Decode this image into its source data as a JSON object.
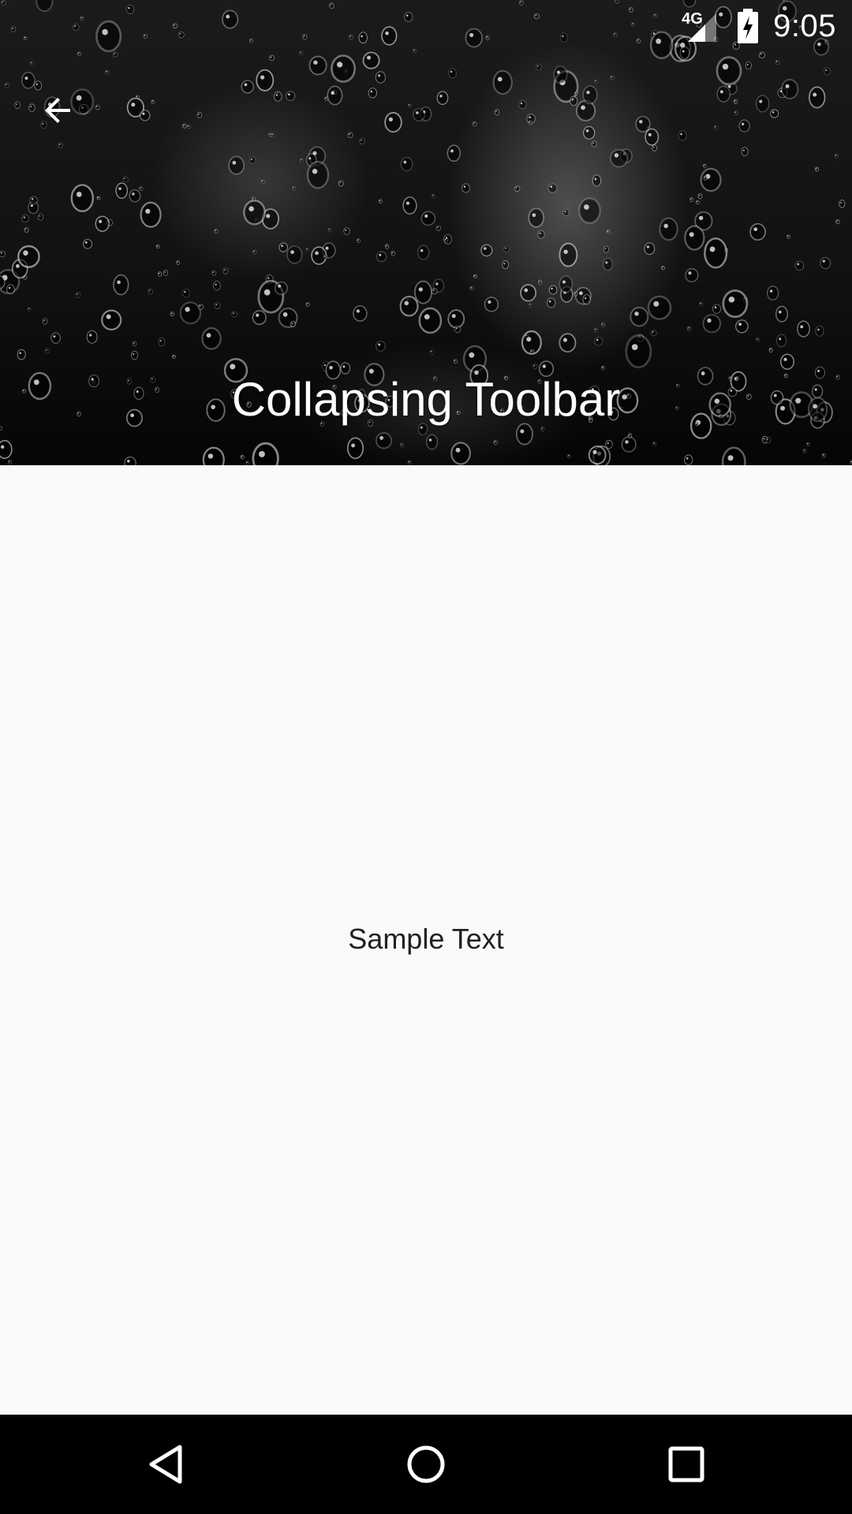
{
  "status_bar": {
    "network_type": "4G",
    "time": "9:05",
    "icons": [
      "signal-icon",
      "battery-charging-icon"
    ]
  },
  "toolbar": {
    "title": "Collapsing Toolbar",
    "back_icon": "arrow-back-icon"
  },
  "content": {
    "text": "Sample Text"
  },
  "nav_bar": {
    "icons": [
      "nav-back-icon",
      "nav-home-icon",
      "nav-recents-icon"
    ]
  },
  "colors": {
    "content_background": "#fafafa",
    "text_primary": "#212121",
    "on_header": "#ffffff",
    "nav_background": "#000000"
  }
}
